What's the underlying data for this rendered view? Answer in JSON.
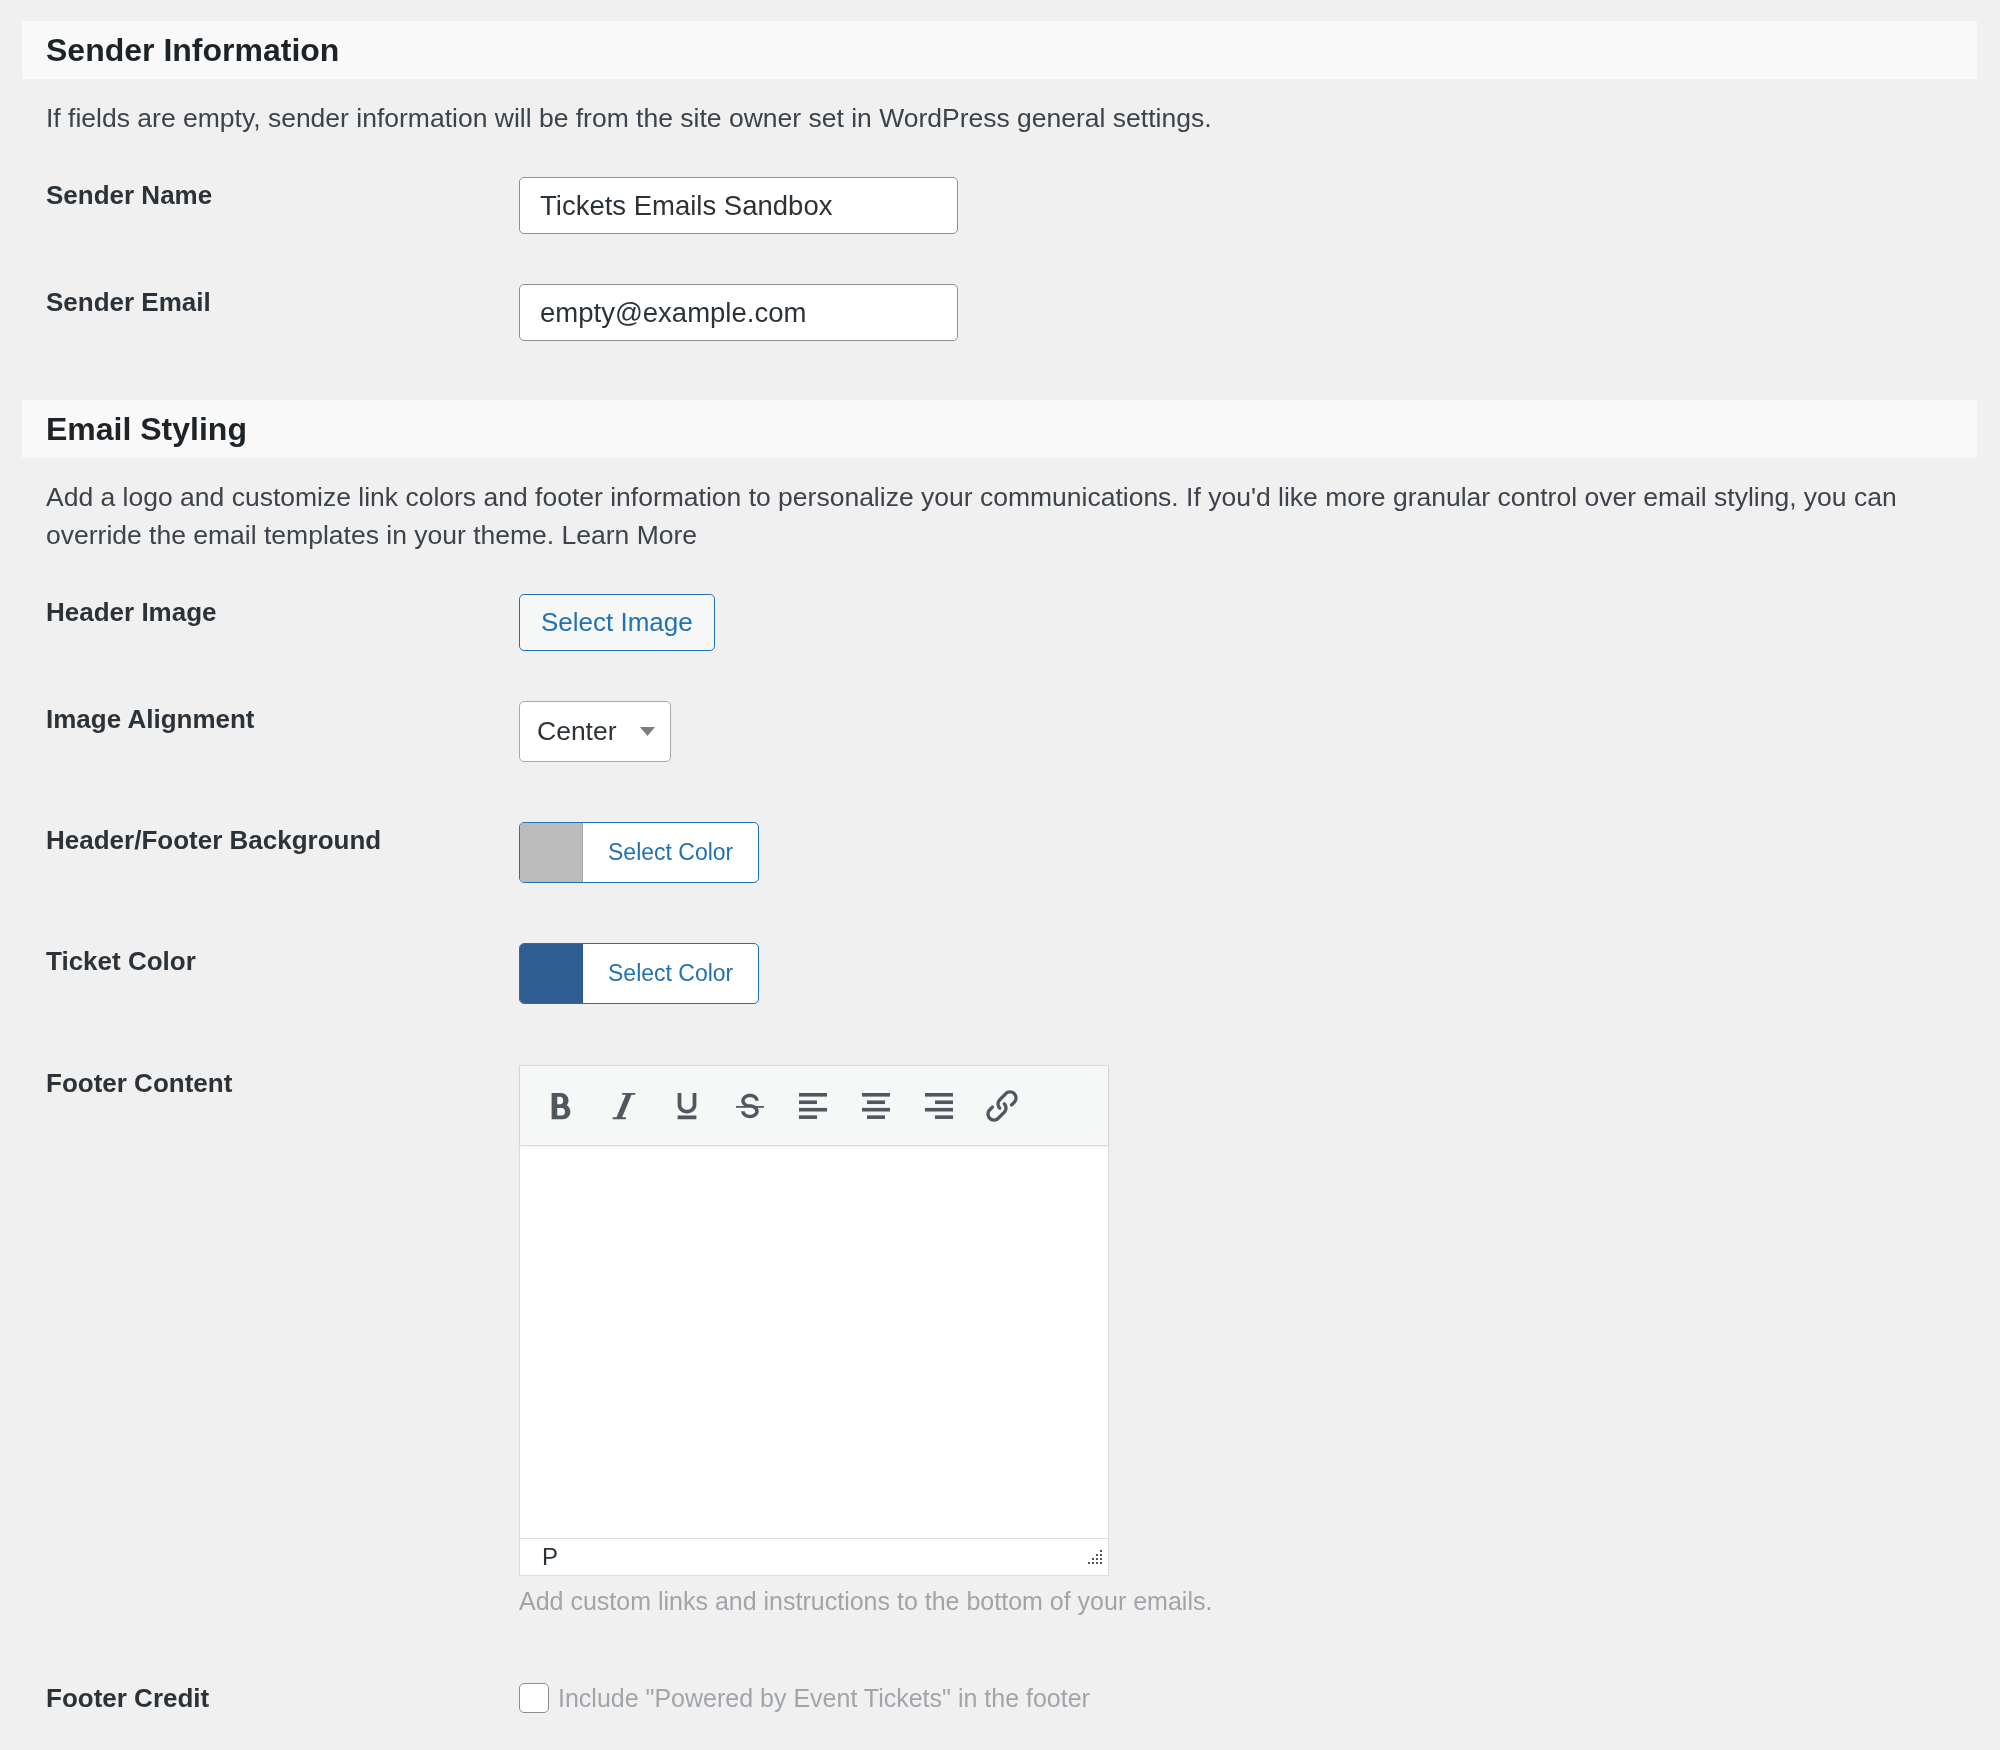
{
  "sections": [
    {
      "title": "Sender Information",
      "description": "If fields are empty, sender information will be from the site owner set in WordPress general settings.",
      "fields": [
        {
          "kind": "text",
          "label": "Sender Name",
          "value": "Tickets Emails Sandbox"
        },
        {
          "kind": "text",
          "label": "Sender Email",
          "value": "empty@example.com"
        }
      ]
    },
    {
      "title": "Email Styling",
      "description": "Add a logo and customize link colors and footer information to personalize your communications. If you'd like more granular control over email styling, you can override the email templates in your theme. Learn More",
      "fields": [
        {
          "kind": "button",
          "label": "Header Image",
          "button": "Select Image"
        },
        {
          "kind": "select",
          "label": "Image Alignment",
          "value": "Center"
        },
        {
          "kind": "color",
          "label": "Header/Footer Background",
          "button": "Select Color",
          "color": "#bbbbbb"
        },
        {
          "kind": "color",
          "label": "Ticket Color",
          "button": "Select Color",
          "color": "#2f5e93"
        },
        {
          "kind": "editor",
          "label": "Footer Content",
          "path": "P",
          "help": "Add custom links and instructions to the bottom of your emails."
        },
        {
          "kind": "checkbox",
          "label": "Footer Credit",
          "text": "Include \"Powered by Event Tickets\" in the footer",
          "checked": false
        }
      ]
    }
  ]
}
